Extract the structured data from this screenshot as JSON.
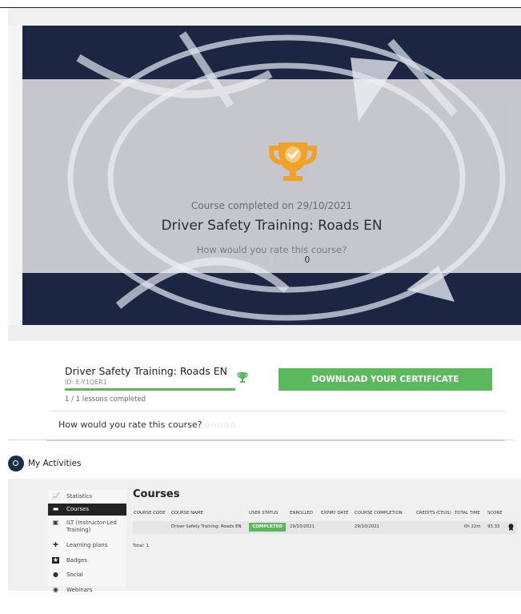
{
  "hero": {
    "completed_on": "Course completed on 29/10/2021",
    "title": "Driver Safety Training: Roads EN",
    "rate_question": "How would you rate this course?",
    "stars": "☆☆☆☆☆",
    "rating_count": "0",
    "trophy_icon": "trophy-check-icon",
    "accent_color": "#f0a12a"
  },
  "course_card": {
    "title": "Driver Safety Training: Roads EN",
    "id": "ID: E-Y1QER1",
    "progress": 1.0,
    "lessons": "1 / 1 lessons completed",
    "download_label": "DOWNLOAD YOUR CERTIFICATE",
    "rate_question": "How would you rate this course?",
    "stars": "☆☆☆☆☆",
    "button_color": "#5cb85c"
  },
  "activities": {
    "title": "My Activities",
    "sidebar": [
      {
        "label": "Statistics",
        "icon": "chart-icon",
        "active": false
      },
      {
        "label": "Courses",
        "icon": "courses-icon",
        "active": true
      },
      {
        "label": "ILT (Instructor-Led Training)",
        "icon": "ilt-icon",
        "active": false
      },
      {
        "label": "Learning plans",
        "icon": "learning-plans-icon",
        "active": false
      },
      {
        "label": "Badges",
        "icon": "badge-icon",
        "active": false
      },
      {
        "label": "Social",
        "icon": "social-icon",
        "active": false
      },
      {
        "label": "Webinars",
        "icon": "webinar-icon",
        "active": false
      }
    ],
    "courses_heading": "Courses",
    "columns": [
      "COURSE CODE",
      "COURSE NAME",
      "USER STATUS",
      "ENROLLED",
      "EXPIRY DATE",
      "COURSE COMPLETION",
      "CREDITS (CEUS)",
      "TOTAL TIME",
      "SCORE"
    ],
    "rows": [
      {
        "code": "",
        "name": "Driver Safety Training: Roads EN",
        "status": "COMPLETED",
        "enrolled": "29/10/2021",
        "expiry": "",
        "completion": "29/10/2021",
        "credits": "",
        "total_time": "0h 22m",
        "score": "93.33"
      }
    ],
    "total": "Total: 1"
  }
}
